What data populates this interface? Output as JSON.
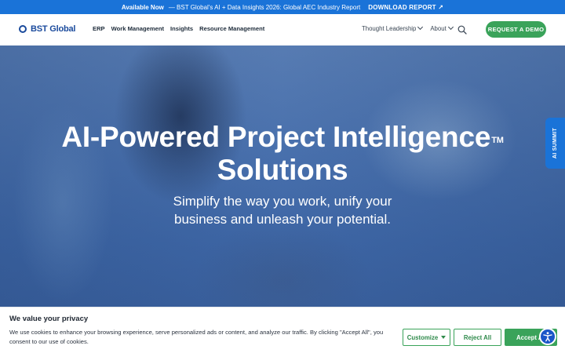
{
  "announcement": {
    "available": "Available Now",
    "text": "— BST Global's AI + Data Insights 2026: Global AEC Industry Report",
    "download": "DOWNLOAD REPORT",
    "arrow": "↗"
  },
  "nav": {
    "logo": "BST Global",
    "links": [
      "ERP",
      "Work Management",
      "Insights",
      "Resource Management"
    ],
    "right_links": [
      "Thought Leadership",
      "About"
    ],
    "cta": "REQUEST A DEMO"
  },
  "hero": {
    "title_line1": "AI-Powered Project Intelligence",
    "trademark": "TM",
    "title_line2": "Solutions",
    "subtitle_line1": "Simplify the way you work, unify your",
    "subtitle_line2": "business and unleash your potential."
  },
  "side_tab": {
    "label": "AI SUMMIT"
  },
  "cookie": {
    "title": "We value your privacy",
    "text": "We use cookies to enhance your browsing experience, serve personalized ads or content, and analyze our traffic. By clicking \"Accept All\", you consent to our use of cookies.",
    "customize": "Customize",
    "reject": "Reject All",
    "accept": "Accept All"
  },
  "colors": {
    "brand_blue": "#1a73d8",
    "green": "#3aa35a",
    "logo_blue": "#1a4a9c"
  },
  "icons": [
    "search-icon",
    "chevron-down-icon",
    "arrow-up-right-icon",
    "accessibility-icon",
    "logo-mark-icon"
  ]
}
